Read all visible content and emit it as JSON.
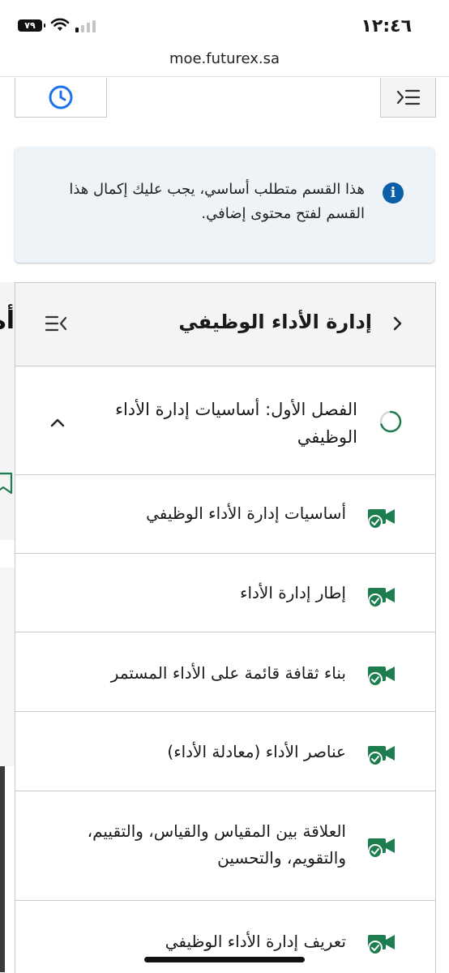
{
  "status_bar": {
    "time": "١٢:٤٦",
    "battery": "٧٩"
  },
  "browser": {
    "url": "moe.futurex.sa"
  },
  "info_banner": {
    "text": "هذا القسم متطلب أساسي، يجب عليك إكمال هذا القسم لفتح محتوى إضافي."
  },
  "left_partial": {
    "heading": "أه إد الأ ال"
  },
  "outline": {
    "title": "إدارة الأداء الوظيفي",
    "section": {
      "title": "الفصل الأول: أساسيات إدارة الأداء الوظيفي"
    },
    "items": [
      {
        "title": "أساسيات إدارة الأداء الوظيفي"
      },
      {
        "title": "إطار إدارة الأداء"
      },
      {
        "title": "بناء ثقافة قائمة على الأداء المستمر"
      },
      {
        "title": "عناصر الأداء (معادلة الأداء)"
      },
      {
        "title": "العلاقة بين المقياس والقياس، والتقييم، والتقويم، والتحسين"
      },
      {
        "title": "تعريف إدارة الأداء الوظيفي"
      }
    ]
  },
  "colors": {
    "accent_green": "#1e7d4f",
    "info_blue": "#0a5fa6",
    "clock_blue": "#1a73e8",
    "banner_bg": "#eef3f8"
  },
  "icons": [
    "clock-icon",
    "outline-menu-icon",
    "info-icon",
    "chevron-right-icon",
    "collapse-list-icon",
    "progress-ring-icon",
    "chevron-up-icon",
    "video-complete-icon"
  ]
}
